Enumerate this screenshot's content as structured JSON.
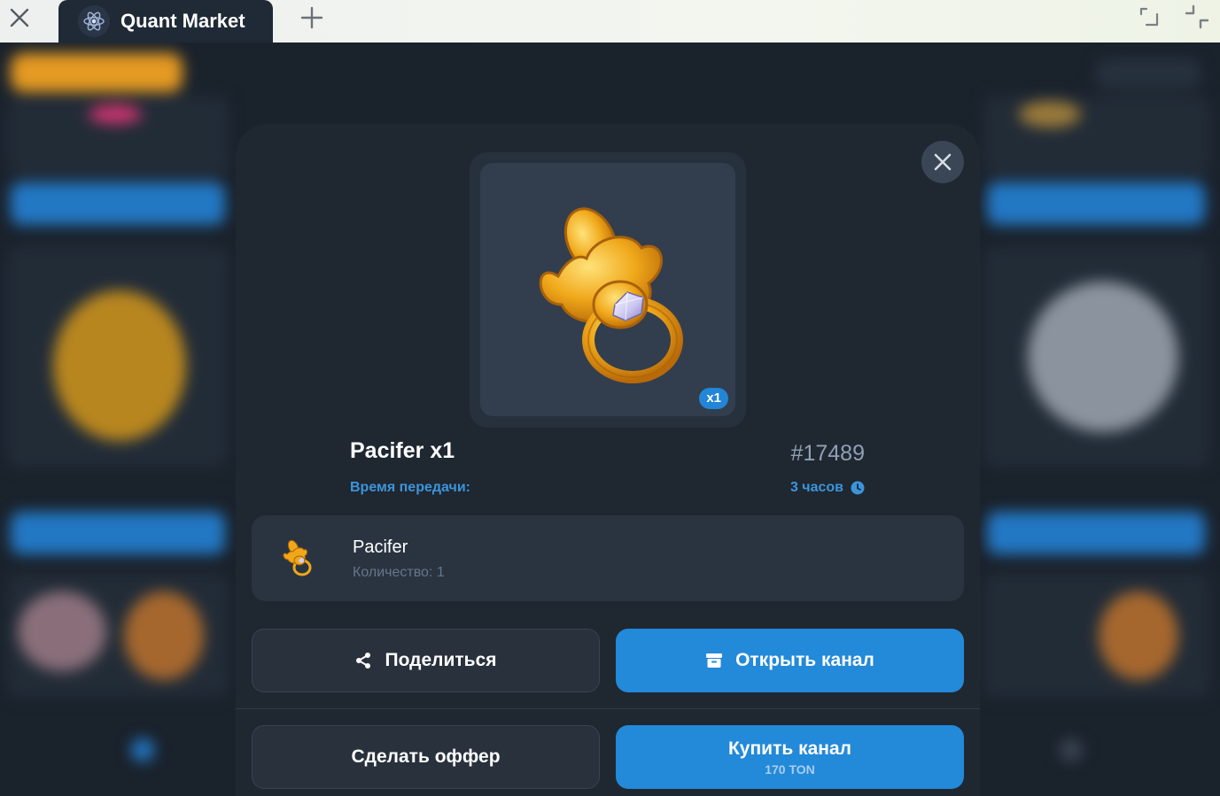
{
  "browser": {
    "tab_title": "Quant Market"
  },
  "modal": {
    "image_badge": "x1",
    "item_title": "Pacifer x1",
    "item_number": "#17489",
    "transfer_label": "Время передачи:",
    "transfer_value": "3 часов",
    "content": {
      "name": "Pacifer",
      "quantity_text": "Количество: 1"
    },
    "buttons": {
      "share": "Поделиться",
      "open_channel": "Открыть канал",
      "make_offer": "Сделать оффер",
      "buy_channel": "Купить канал",
      "buy_price": "170 TON"
    }
  },
  "colors": {
    "accent": "#2389d9",
    "modal_bg": "#1f2731",
    "link_text": "#3b95db"
  },
  "icons": [
    "close-icon",
    "atom-logo-icon",
    "plus-icon",
    "minimize-icon",
    "exit-fullscreen-icon",
    "clock-icon",
    "share-icon",
    "archive-icon",
    "pacifier-icon"
  ]
}
